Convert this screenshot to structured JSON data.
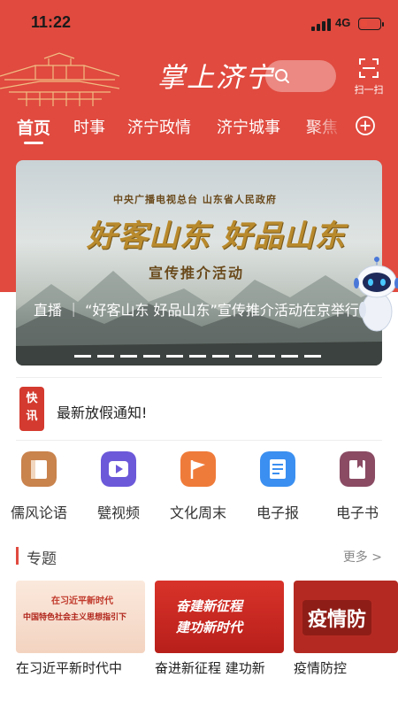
{
  "status": {
    "time": "11:22",
    "network": "4G"
  },
  "header": {
    "app_title": "掌上济宁",
    "scan_label": "扫一扫"
  },
  "tabs": [
    {
      "label": "首页"
    },
    {
      "label": "时事"
    },
    {
      "label": "济宁政情"
    },
    {
      "label": "济宁城事"
    },
    {
      "label": "聚焦"
    }
  ],
  "banner": {
    "sub_line": "中央广播电视总台   山东省人民政府",
    "headline": "好客山东  好品山东",
    "activity": "宣传推介活动",
    "caption": "直播 ｜ “好客山东 好品山东”宣传推介活动在京举行"
  },
  "flash": {
    "badge_top": "快",
    "badge_bottom": "讯",
    "text": "最新放假通知!"
  },
  "quick_nav": [
    {
      "label": "儒风论语",
      "icon": "book-icon",
      "color": "#c9834d"
    },
    {
      "label": "甓视频",
      "icon": "play-icon",
      "color": "#6b59d9"
    },
    {
      "label": "文化周末",
      "icon": "flag-icon",
      "color": "#ef7b3a"
    },
    {
      "label": "电子报",
      "icon": "newspaper-icon",
      "color": "#3b8ff0"
    },
    {
      "label": "电子书",
      "icon": "ebook-icon",
      "color": "#8a4b63"
    }
  ],
  "special": {
    "title": "专题",
    "more": "更多 >",
    "cards": [
      {
        "title": "在习近平新时代中",
        "img_line1": "在习近平新时代",
        "img_line2": "中国特色社会主义思想指引下"
      },
      {
        "title": "奋进新征程  建功新",
        "img_line1": "奋建新征程",
        "img_line2": "建功新时代"
      },
      {
        "title": "疫情防控",
        "img_line1": "疫情防",
        "img_line2": ""
      }
    ]
  }
}
